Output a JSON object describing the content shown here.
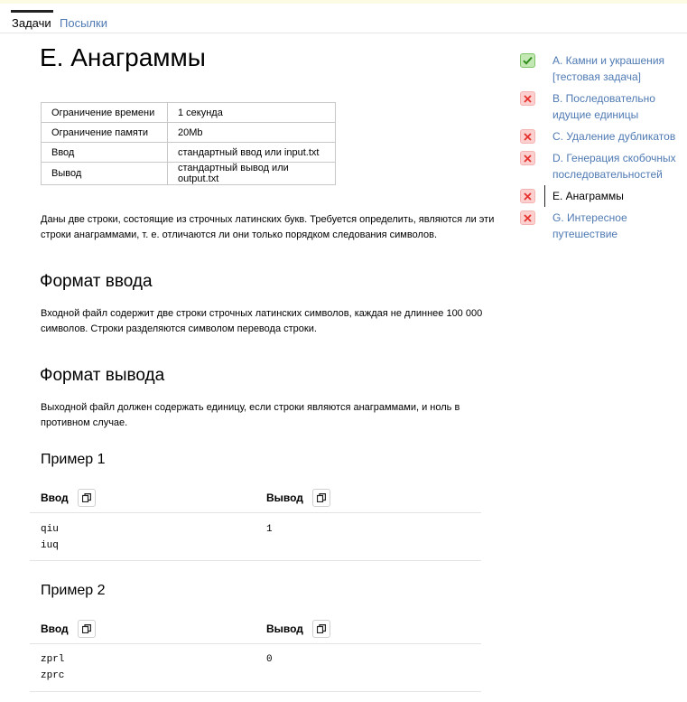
{
  "tabs": {
    "tasks": "Задачи",
    "submissions": "Посылки"
  },
  "problem": {
    "title": "E. Анаграммы",
    "limits": [
      {
        "key": "Ограничение времени",
        "value": "1 секунда"
      },
      {
        "key": "Ограничение памяти",
        "value": "20Mb"
      },
      {
        "key": "Ввод",
        "value": "стандартный ввод или input.txt"
      },
      {
        "key": "Вывод",
        "value": "стандартный вывод или output.txt"
      }
    ],
    "statement": "Даны две строки, состоящие из строчных латинских букв. Требуется определить, являются ли эти строки анаграммами, т. е. отличаются ли они только порядком следования символов.",
    "input_format": {
      "heading": "Формат ввода",
      "text": "Входной файл содержит две строки строчных латинских символов, каждая не длиннее 100 000 символов. Строки разделяются символом перевода строки."
    },
    "output_format": {
      "heading": "Формат вывода",
      "text": "Выходной файл должен содержать единицу, если строки являются анаграммами, и ноль в противном случае."
    },
    "examples": [
      {
        "title": "Пример 1",
        "input_label": "Ввод",
        "output_label": "Вывод",
        "input": "qiu\niuq",
        "output": "1"
      },
      {
        "title": "Пример 2",
        "input_label": "Ввод",
        "output_label": "Вывод",
        "input": "zprl\nzprc",
        "output": "0"
      }
    ]
  },
  "sidebar": {
    "items": [
      {
        "label": "A. Камни и украшения [тестовая задача]",
        "status": "accepted"
      },
      {
        "label": "B. Последовательно идущие единицы",
        "status": "failed"
      },
      {
        "label": "C. Удаление дубликатов",
        "status": "failed"
      },
      {
        "label": "D. Генерация скобочных последовательностей",
        "status": "failed"
      },
      {
        "label": "E. Анаграммы",
        "status": "failed",
        "current": true
      },
      {
        "label": "G. Интересное путешествие",
        "status": "failed"
      }
    ]
  },
  "colors": {
    "link": "#4f7ab3",
    "ok_icon": "#2e8c1b",
    "fail_icon": "#e5322d"
  }
}
